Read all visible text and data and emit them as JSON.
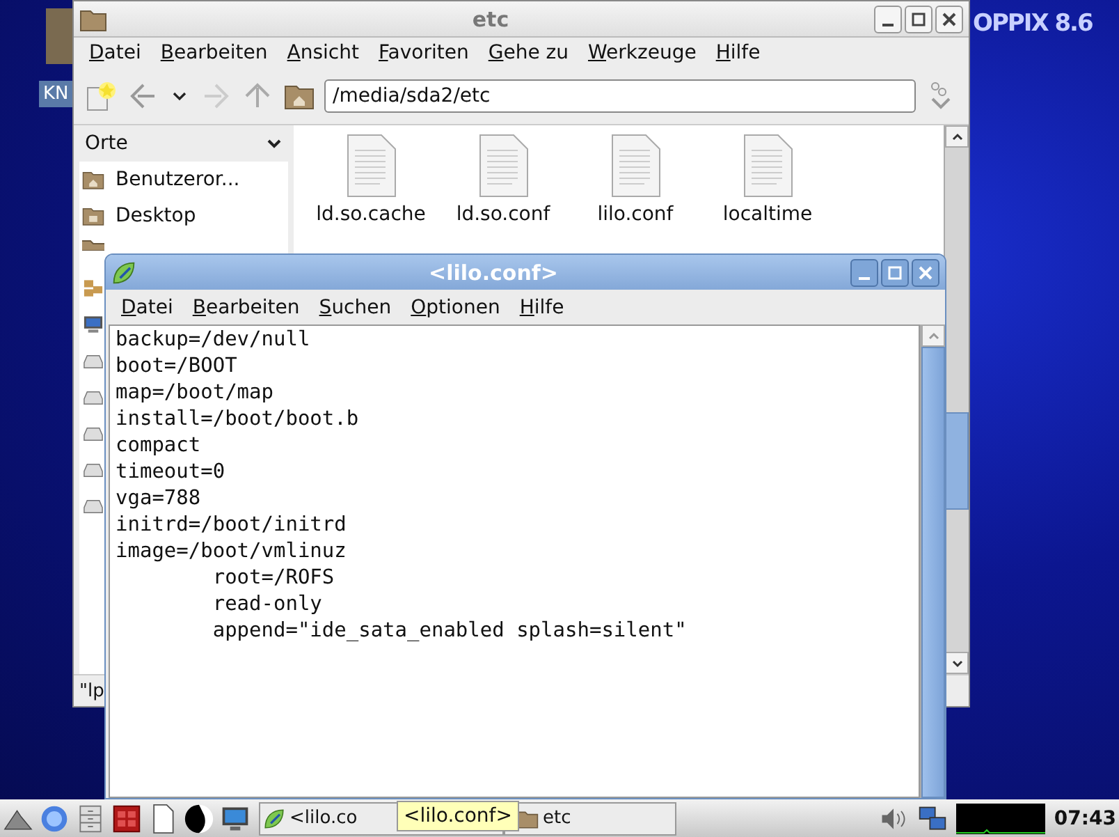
{
  "desktop": {
    "icon_label": "KN",
    "logo_text": "OPPIX 8.6"
  },
  "file_manager": {
    "title": "etc",
    "menu": [
      "Datei",
      "Bearbeiten",
      "Ansicht",
      "Favoriten",
      "Gehe zu",
      "Werkzeuge",
      "Hilfe"
    ],
    "location": "/media/sda2/etc",
    "sidebar": {
      "heading": "Orte",
      "items": [
        {
          "kind": "home",
          "label": "Benutzeror..."
        },
        {
          "kind": "desktop",
          "label": "Desktop"
        },
        {
          "kind": "folder"
        },
        {
          "kind": "network"
        },
        {
          "kind": "computer"
        },
        {
          "kind": "drive"
        },
        {
          "kind": "drive"
        },
        {
          "kind": "drive"
        },
        {
          "kind": "drive"
        },
        {
          "kind": "drive"
        }
      ]
    },
    "files": [
      "ld.so.cache",
      "ld.so.conf",
      "lilo.conf",
      "localtime"
    ],
    "status": "\"lp"
  },
  "editor": {
    "title": "<lilo.conf>",
    "menu": [
      "Datei",
      "Bearbeiten",
      "Suchen",
      "Optionen",
      "Hilfe"
    ],
    "lines": [
      "backup=/dev/null",
      "boot=/BOOT",
      "map=/boot/map",
      "install=/boot/boot.b",
      "compact",
      "timeout=0",
      "vga=788",
      "initrd=/boot/initrd",
      "image=/boot/vmlinuz",
      "        root=/ROFS",
      "        read-only",
      "        append=\"ide_sata_enabled splash=silent\""
    ]
  },
  "taskbar": {
    "tasks": [
      {
        "kind": "editor",
        "label": "<lilo.co"
      },
      {
        "kind": "folder",
        "label": "etc"
      }
    ],
    "tooltip": "<lilo.conf>",
    "clock": "07:43"
  }
}
